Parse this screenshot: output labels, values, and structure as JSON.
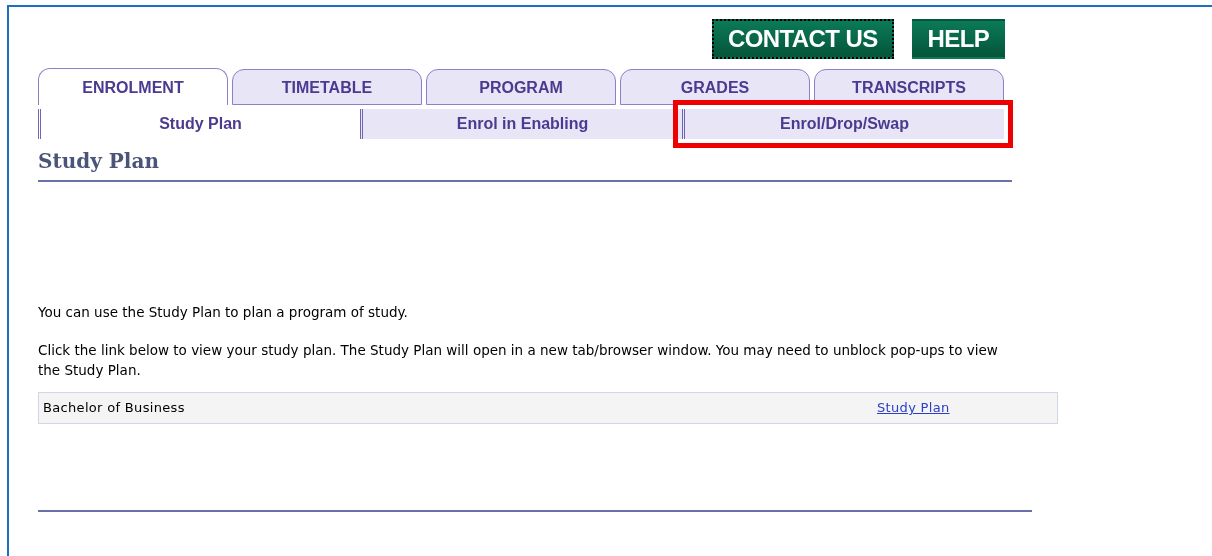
{
  "header_buttons": [
    {
      "label": "CONTACT US",
      "focused": true
    },
    {
      "label": "HELP",
      "focused": false
    }
  ],
  "tabs": [
    {
      "label": "ENROLMENT",
      "selected": true
    },
    {
      "label": "TIMETABLE",
      "selected": false
    },
    {
      "label": "PROGRAM",
      "selected": false
    },
    {
      "label": "GRADES",
      "selected": false
    },
    {
      "label": "TRANSCRIPTS",
      "selected": false
    }
  ],
  "subtabs": [
    {
      "label": "Study Plan",
      "selected": true,
      "highlighted": false
    },
    {
      "label": "Enrol in Enabling",
      "selected": false,
      "highlighted": false
    },
    {
      "label": "Enrol/Drop/Swap",
      "selected": false,
      "highlighted": true
    }
  ],
  "heading": "Study Plan",
  "paragraphs": [
    "You can use the Study Plan to plan a program of study.",
    "Click the link below to view your study plan. The Study Plan will open in a new tab/browser window. You may need to unblock pop-ups to view the Study Plan."
  ],
  "table": {
    "rows": [
      {
        "program": "Bachelor of Business",
        "link": "Study Plan"
      }
    ]
  }
}
